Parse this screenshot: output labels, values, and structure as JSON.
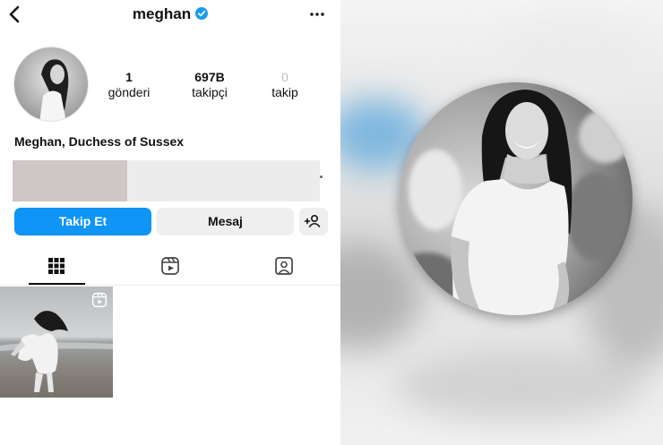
{
  "profile": {
    "username": "meghan",
    "full_name": "Meghan, Duchess of Sussex",
    "stats": {
      "posts_count": "1",
      "posts_label": "gönderi",
      "followers_count": "697B",
      "followers_label": "takipçi",
      "following_count": "0",
      "following_label": "takip"
    }
  },
  "actions": {
    "follow_label": "Takip Et",
    "message_label": "Mesaj"
  },
  "icons": {
    "back": "chevron-left-icon",
    "verified": "verified-badge-icon",
    "more": "more-horizontal-icon",
    "add_user": "add-person-icon",
    "grid": "grid-icon",
    "reels": "reels-icon",
    "tagged": "tagged-person-icon"
  },
  "colors": {
    "follow_button": "#0f95f5",
    "verified": "#1a9bf0",
    "secondary_button": "#efefef"
  }
}
